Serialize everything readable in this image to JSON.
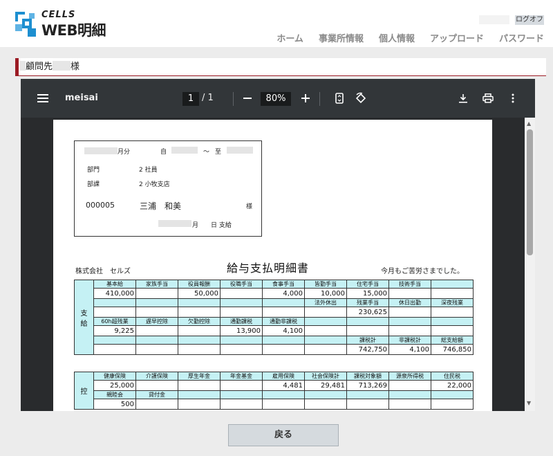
{
  "header": {
    "logo_top": "CELLS",
    "logo_main": "WEB明細",
    "logout_label": "ログオフ",
    "nav": [
      "ホーム",
      "事業所情報",
      "個人情報",
      "アップロード",
      "パスワード"
    ]
  },
  "destination": {
    "prefix": "顧問先",
    "suffix": "様"
  },
  "viewer": {
    "file_name": "meisai",
    "page_current": "1",
    "page_total": "/ 1",
    "zoom": "80%",
    "icons": [
      "menu-icon",
      "zoom-out-icon",
      "zoom-in-icon",
      "fit-page-icon",
      "rotate-icon",
      "download-icon",
      "print-icon",
      "more-icon"
    ]
  },
  "payslip": {
    "period_month": "月分",
    "from": "自",
    "tilde": "～",
    "to": "至",
    "dept_label": "部門",
    "dept_value": "2 社員",
    "section_label": "部課",
    "section_value": "2 小牧支店",
    "employee_id": "000005",
    "employee_name": "三浦　和美",
    "honorific": "様",
    "pay_day": "月　　日 支給",
    "company": "株式会社　セルズ",
    "title": "給与支払明細書",
    "thanks": "今月もご苦労さまでした。",
    "pay_side": "支\n給",
    "deduct_side": "控",
    "pay_rows": [
      {
        "headers": [
          "基本給",
          "家族手当",
          "役員報酬",
          "役職手当",
          "食事手当",
          "皆勤手当",
          "住宅手当",
          "技術手当",
          ""
        ],
        "values": [
          "410,000",
          "",
          "50,000",
          "",
          "4,000",
          "10,000",
          "15,000",
          "",
          ""
        ]
      },
      {
        "headers": [
          "",
          "",
          "",
          "",
          "",
          "法外休出",
          "残業手当",
          "休日出勤",
          "深夜残業"
        ],
        "values": [
          "",
          "",
          "",
          "",
          "",
          "",
          "230,625",
          "",
          ""
        ]
      },
      {
        "headers": [
          "60h超残業",
          "遅早控除",
          "欠勤控除",
          "通勤課税",
          "通勤非課税",
          "",
          "",
          "",
          ""
        ],
        "values": [
          "9,225",
          "",
          "",
          "13,900",
          "4,100",
          "",
          "",
          "",
          ""
        ]
      },
      {
        "headers": [
          "",
          "",
          "",
          "",
          "",
          "",
          "課税計",
          "非課税計",
          "総支給額"
        ],
        "values": [
          "",
          "",
          "",
          "",
          "",
          "",
          "742,750",
          "4,100",
          "746,850"
        ]
      }
    ],
    "deduct_rows": [
      {
        "headers": [
          "健康保険",
          "介護保険",
          "厚生年金",
          "年金基金",
          "雇用保険",
          "社会保険計",
          "課税対象額",
          "源泉所得税",
          "住民税"
        ],
        "values": [
          "25,000",
          "",
          "",
          "",
          "4,481",
          "29,481",
          "713,269",
          "",
          "22,000"
        ]
      },
      {
        "headers": [
          "親睦会",
          "貸付金",
          "",
          "",
          "",
          "",
          "",
          "",
          ""
        ],
        "values": [
          "500",
          "",
          "",
          "",
          "",
          "",
          "",
          "",
          ""
        ]
      }
    ]
  },
  "footer": {
    "back_label": "戻る"
  }
}
